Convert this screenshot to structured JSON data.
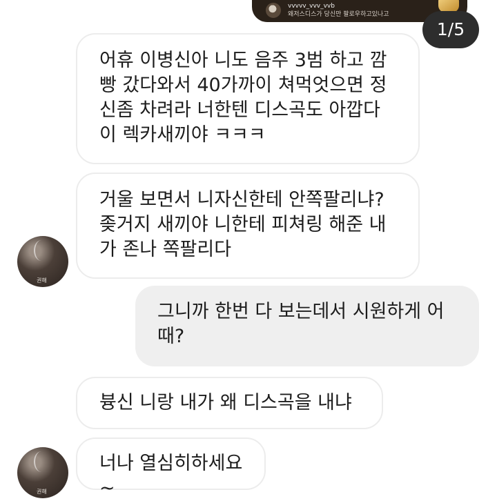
{
  "story_reply": {
    "username": "vvvvv_vvv_vvb",
    "text": "왜저스디스가 당신만 팔로우하고있나고"
  },
  "page_indicator": "1/5",
  "messages": [
    {
      "side": "received",
      "text": "어휴 이병신아 니도 음주 3범 하고 깜빵 갔다와서 40가까이 쳐먹엇으면 정신좀 차려라 너한텐 디스곡도 아깝다 이 렉카새끼야 ㅋㅋㅋ"
    },
    {
      "side": "received",
      "text": "거울 보면서 니자신한테 안쪽팔리냐? 좆거지 새끼야 니한테 피쳐링 해준 내가 존나 쪽팔리다"
    },
    {
      "side": "sent",
      "text": "그니까 한번 다 보는데서 시원하게 어때?"
    },
    {
      "side": "received",
      "text": "븅신 니랑 내가 왜 디스곡을 내냐"
    },
    {
      "side": "received",
      "text": "너나 열심히하세요~"
    }
  ],
  "avatar_label": "권해",
  "colors": {
    "sent_bubble": "#efefef",
    "received_border": "#ececec",
    "indicator_bg": "#2d2d2d"
  }
}
